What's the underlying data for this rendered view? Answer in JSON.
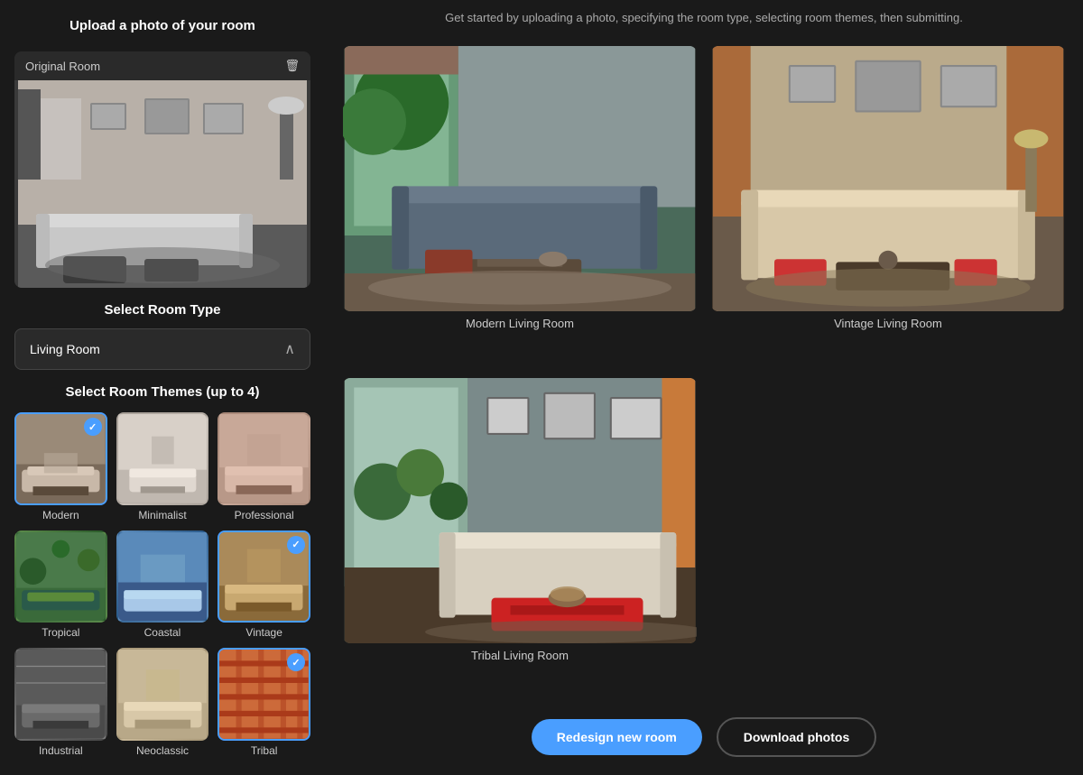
{
  "leftPanel": {
    "uploadTitle": "Upload a photo of your room",
    "originalRoomLabel": "Original Room",
    "roomTypeTitle": "Select Room Type",
    "selectedRoomType": "Living Room",
    "themesTitle": "Select Room Themes (up to 4)",
    "themes": [
      {
        "id": "modern",
        "label": "Modern",
        "selected": true,
        "class": "theme-modern"
      },
      {
        "id": "minimalist",
        "label": "Minimalist",
        "selected": false,
        "class": "theme-minimalist"
      },
      {
        "id": "professional",
        "label": "Professional",
        "selected": false,
        "class": "theme-professional"
      },
      {
        "id": "tropical",
        "label": "Tropical",
        "selected": false,
        "class": "theme-tropical"
      },
      {
        "id": "coastal",
        "label": "Coastal",
        "selected": false,
        "class": "theme-coastal"
      },
      {
        "id": "vintage",
        "label": "Vintage",
        "selected": true,
        "class": "theme-vintage"
      },
      {
        "id": "industrial",
        "label": "Industrial",
        "selected": false,
        "class": "theme-industrial"
      },
      {
        "id": "neoclassic",
        "label": "Neoclassic",
        "selected": false,
        "class": "theme-neoclassic"
      },
      {
        "id": "tribal",
        "label": "Tribal",
        "selected": true,
        "class": "theme-tribal"
      }
    ]
  },
  "rightPanel": {
    "subtitle": "Get started by uploading a photo, specifying the room type, selecting room themes, then submitting.",
    "results": [
      {
        "id": "modern-living",
        "label": "Modern Living Room",
        "imgClass": "img-modern-living"
      },
      {
        "id": "vintage-living",
        "label": "Vintage Living Room",
        "imgClass": "img-vintage-living"
      },
      {
        "id": "tribal-living",
        "label": "Tribal Living Room",
        "imgClass": "img-tribal-living"
      }
    ],
    "buttons": {
      "redesign": "Redesign new room",
      "download": "Download photos"
    }
  }
}
